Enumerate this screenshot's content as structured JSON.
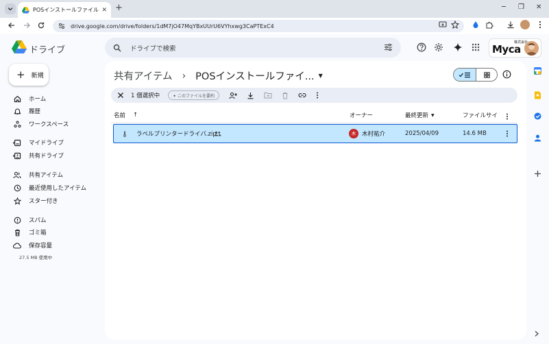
{
  "browser": {
    "tab_title": "POSインストールファイル - Google ドライブ",
    "tab_close": "✕",
    "new_tab": "+",
    "url": "drive.google.com/drive/folders/1dM7jO47MqYBxUUrU6VYhxwg3CaPTExC4",
    "minimize": "─",
    "restore": "❐",
    "close": "✕"
  },
  "header": {
    "app_name": "ドライブ",
    "search_placeholder": "ドライブで検索",
    "brand_sub": "株式会社",
    "brand_name": "Myca"
  },
  "sidebar": {
    "new_label": "新規",
    "items": [
      {
        "label": "ホーム",
        "icon": "home-icon"
      },
      {
        "label": "履歴",
        "icon": "bell-icon"
      },
      {
        "label": "ワークスペース",
        "icon": "workspace-icon"
      },
      {
        "label": "マイドライブ",
        "icon": "my-drive-icon"
      },
      {
        "label": "共有ドライブ",
        "icon": "shared-drive-icon"
      },
      {
        "label": "共有アイテム",
        "icon": "people-icon"
      },
      {
        "label": "最近使用したアイテム",
        "icon": "clock-icon"
      },
      {
        "label": "スター付き",
        "icon": "star-icon"
      },
      {
        "label": "スパム",
        "icon": "spam-icon"
      },
      {
        "label": "ゴミ箱",
        "icon": "trash-icon"
      },
      {
        "label": "保存容量",
        "icon": "cloud-icon"
      }
    ],
    "storage_used": "27.5 MB 使用中"
  },
  "main": {
    "breadcrumb_parent": "共有アイテム",
    "breadcrumb_sep": "›",
    "breadcrumb_current": "POSインストールファイ...",
    "selection_count": "1 個選択中",
    "summarize_label": "✦ このファイルを要約",
    "columns": {
      "name": "名前",
      "sort_arrow": "↑",
      "owner": "オーナー",
      "modified": "最終更新",
      "size": "ファイルサイ"
    },
    "files": [
      {
        "name": "ラベルプリンタードライバ.zip",
        "owner_initial": "木",
        "owner": "木村祐介",
        "modified": "2025/04/09",
        "size": "14.6 MB"
      }
    ]
  },
  "colors": {
    "selected_row": "#c2e7ff",
    "selected_border": "#0b57d0",
    "owner_avatar": "#c62828",
    "page_bg": "#f8fafd"
  }
}
